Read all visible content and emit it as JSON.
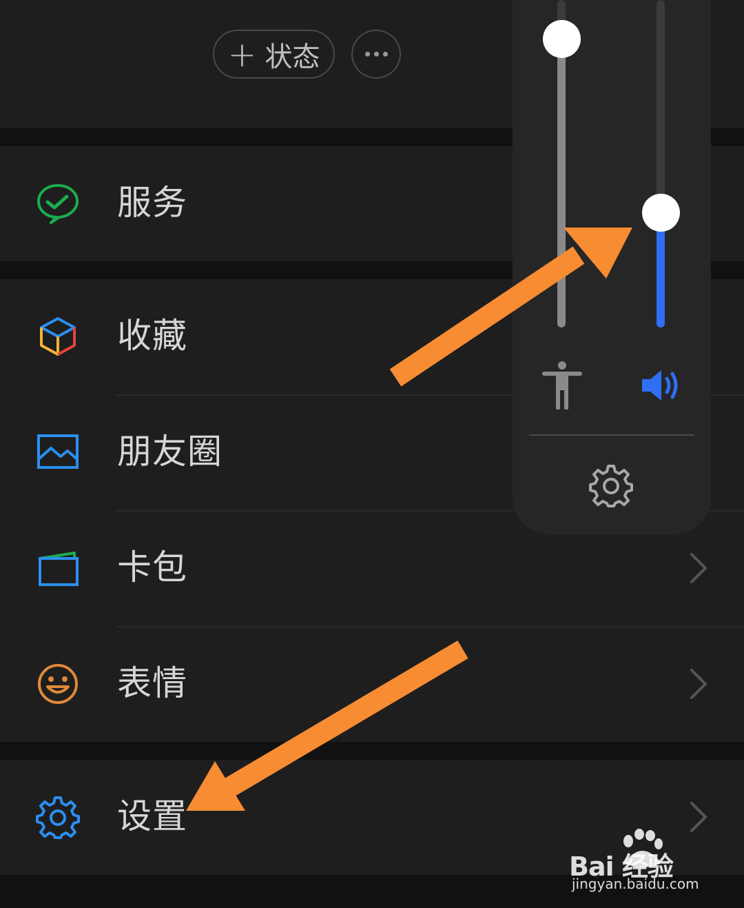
{
  "header": {
    "status_button": {
      "plus": "+",
      "label": "状态"
    },
    "more_button": {
      "icon": "more-dots-icon"
    }
  },
  "menu": {
    "services": {
      "label": "服务",
      "icon": "wechat-pay-icon",
      "color": "#1aad4e"
    },
    "favorites": {
      "label": "收藏",
      "icon": "cube-icon"
    },
    "moments": {
      "label": "朋友圈",
      "icon": "picture-icon",
      "color": "#2b8ff0"
    },
    "wallet": {
      "label": "卡包",
      "icon": "wallet-icon",
      "color": "#2b8ff0"
    },
    "stickers": {
      "label": "表情",
      "icon": "smiley-icon",
      "color": "#e0893a"
    },
    "settings": {
      "label": "设置",
      "icon": "gear-icon",
      "color": "#2b8ff0"
    }
  },
  "volume_panel": {
    "accessibility_level": 0.88,
    "media_level": 0.35,
    "accent": "#2f6ef5",
    "icons": [
      "accessibility-icon",
      "speaker-icon",
      "settings-gear-icon"
    ]
  },
  "annotation_color": "#f78c33",
  "watermark": {
    "logo": "Bai  经验",
    "url": "jingyan.baidu.com"
  }
}
